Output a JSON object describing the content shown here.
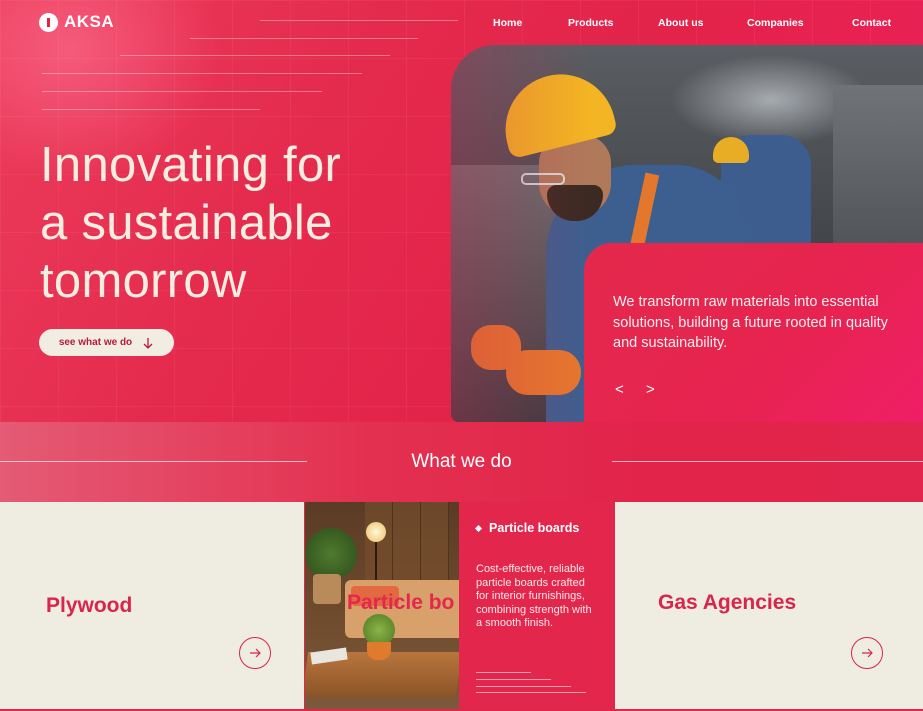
{
  "brand": {
    "name": "AKSA"
  },
  "nav": {
    "items": [
      {
        "label": "Home"
      },
      {
        "label": "Products"
      },
      {
        "label": "About us"
      },
      {
        "label": "Companies"
      },
      {
        "label": "Contact"
      }
    ]
  },
  "hero": {
    "headline_lines": [
      "Innovating for",
      "a sustainable",
      "tomorrow"
    ],
    "cta_label": "see what we do",
    "cta_icon": "arrow-down-icon",
    "description": "We transform raw materials into essential solutions, building a future rooted in quality and sustainability.",
    "prev_label": "<",
    "next_label": ">"
  },
  "section": {
    "title": "What we do"
  },
  "products": {
    "plywood": {
      "title": "Plywood",
      "icon": "arrow-right-icon"
    },
    "particle_boards": {
      "title_overlay": "Particle bo",
      "heading": "Particle boards",
      "description": "Cost-effective, reliable particle boards crafted for interior furnishings, combining strength with a smooth finish."
    },
    "gas_agencies": {
      "title": "Gas Agencies",
      "icon": "arrow-right-icon"
    }
  },
  "colors": {
    "brand_red": "#e3234a",
    "cream": "#efece2",
    "heading_text": "#f4eee1"
  }
}
